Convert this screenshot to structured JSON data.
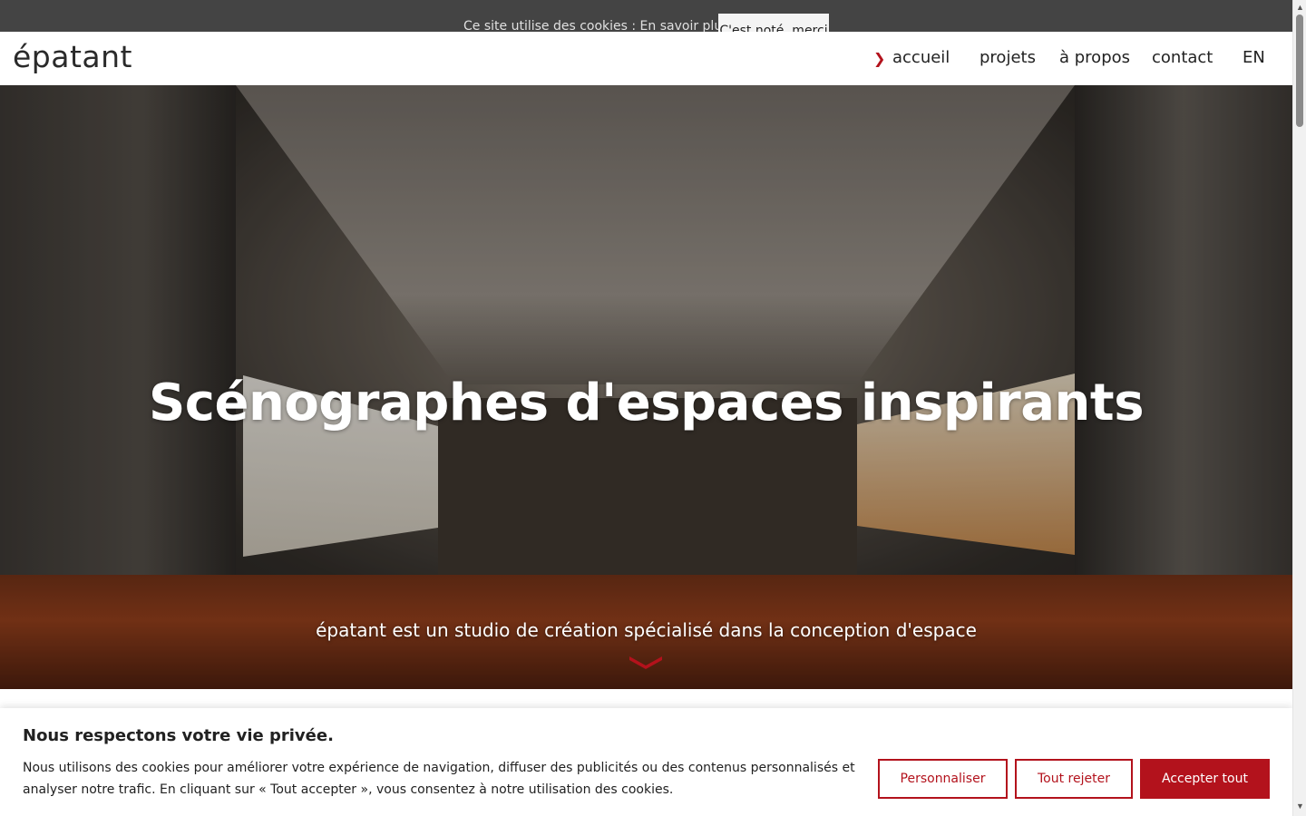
{
  "cookie_strip": {
    "text": "Ce site utilise des cookies : En savoir plus.",
    "button": "C'est noté, merci"
  },
  "header": {
    "logo": "épatant",
    "nav": [
      "accueil",
      "projets",
      "à propos",
      "contact"
    ],
    "active_marker": "❯",
    "language": "EN"
  },
  "hero": {
    "title": "Scénographes d'espaces inspirants",
    "subtitle": "épatant est un studio de création spécialisé dans la conception d'espace",
    "scroll_icon": "chevron-down-icon"
  },
  "consent": {
    "title": "Nous respectons votre vie privée.",
    "body": "Nous utilisons des cookies pour améliorer votre expérience de navigation, diffuser des publicités ou des contenus personnalisés et analyser notre trafic. En cliquant sur « Tout accepter », vous consentez à notre utilisation des cookies.",
    "buttons": {
      "customize": "Personnaliser",
      "reject": "Tout rejeter",
      "accept": "Accepter tout"
    }
  },
  "colors": {
    "accent": "#b3121c",
    "strip_bg": "#444444",
    "text": "#212121"
  }
}
